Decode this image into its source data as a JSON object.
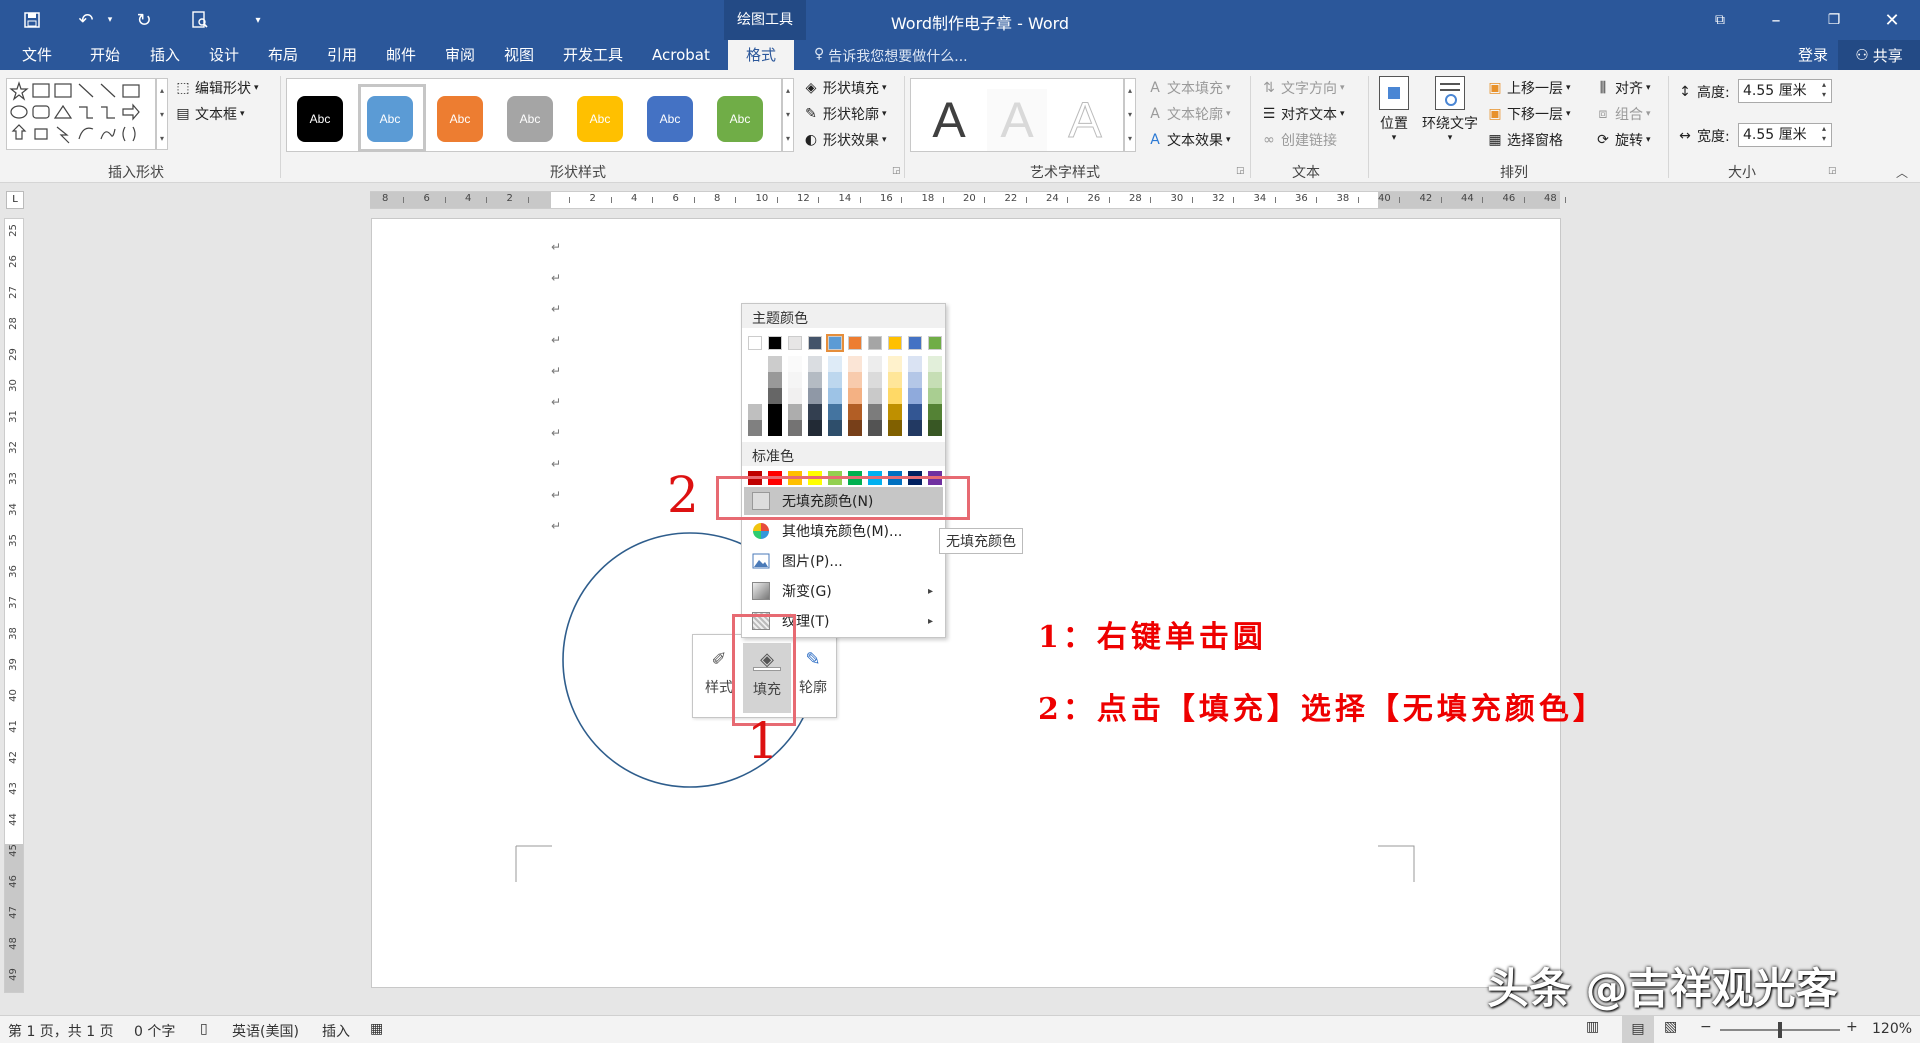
{
  "titlebar": {
    "context": "绘图工具",
    "title": "Word制作电子章 - Word"
  },
  "tabs": [
    "文件",
    "开始",
    "插入",
    "设计",
    "布局",
    "引用",
    "邮件",
    "审阅",
    "视图",
    "开发工具",
    "Acrobat",
    "格式"
  ],
  "active_tab": "格式",
  "tellme": "告诉我您想要做什么...",
  "account": {
    "login": "登录",
    "share": "共享"
  },
  "ribbon": {
    "insert_shapes": {
      "edit_shape": "编辑形状",
      "textbox": "文本框",
      "label": "插入形状"
    },
    "shape_styles": {
      "swatch_text": "Abc",
      "swatch_colors": [
        "#000000",
        "#5b9bd5",
        "#ed7d31",
        "#a5a5a5",
        "#ffc000",
        "#4472c4",
        "#70ad47"
      ],
      "fill": "形状填充",
      "outline": "形状轮廓",
      "effects": "形状效果",
      "label": "形状样式"
    },
    "wordart": {
      "letter": "A",
      "fill": "文本填充",
      "outline": "文本轮廓",
      "effects": "文本效果",
      "label": "艺术字样式"
    },
    "text": {
      "direction": "文字方向",
      "align": "对齐文本",
      "link": "创建链接",
      "label": "文本"
    },
    "arrange": {
      "position": "位置",
      "wrap": "环绕文字",
      "forward": "上移一层",
      "backward": "下移一层",
      "pane": "选择窗格",
      "align": "对齐",
      "group": "组合",
      "rotate": "旋转",
      "label": "排列"
    },
    "size": {
      "height_label": "高度:",
      "height": "4.55 厘米",
      "width_label": "宽度:",
      "width": "4.55 厘米",
      "label": "大小"
    }
  },
  "hruler_ticks": [
    "8",
    "6",
    "4",
    "2",
    "",
    "2",
    "4",
    "6",
    "8",
    "10",
    "12",
    "14",
    "16",
    "18",
    "20",
    "22",
    "24",
    "26",
    "28",
    "30",
    "32",
    "34",
    "36",
    "38",
    "40",
    "42",
    "44",
    "46",
    "48"
  ],
  "vruler_ticks": [
    "25",
    "26",
    "27",
    "28",
    "29",
    "30",
    "31",
    "32",
    "33",
    "34",
    "35",
    "36",
    "37",
    "38",
    "39",
    "40",
    "41",
    "42",
    "43",
    "44",
    "45",
    "46",
    "47",
    "48",
    "49"
  ],
  "para_mark": "↵",
  "menu": {
    "theme_title": "主题颜色",
    "theme_colors": [
      "#ffffff",
      "#000000",
      "#e7e6e6",
      "#44546a",
      "#5b9bd5",
      "#ed7d31",
      "#a5a5a5",
      "#ffc000",
      "#4472c4",
      "#70ad47"
    ],
    "standard_title": "标准色",
    "standard_colors": [
      "#c00000",
      "#ff0000",
      "#ffc000",
      "#ffff00",
      "#92d050",
      "#00b050",
      "#00b0f0",
      "#0070c0",
      "#002060",
      "#7030a0"
    ],
    "no_fill": "无填充颜色(N)",
    "more_colors": "其他填充颜色(M)...",
    "picture": "图片(P)...",
    "gradient": "渐变(G)",
    "texture": "纹理(T)"
  },
  "tooltip": "无填充颜色",
  "mini_toolbar": {
    "style": "样式",
    "fill": "填充",
    "outline": "轮廓"
  },
  "annotations": {
    "num1": "1",
    "num2": "2",
    "step1": "1：右键单击圆",
    "step2": "2：点击【填充】选择【无填充颜色】"
  },
  "statusbar": {
    "page": "第 1 页，共 1 页",
    "words": "0 个字",
    "lang": "英语(美国)",
    "mode": "插入",
    "zoom": "120%"
  },
  "watermark": "头条 @吉祥观光客"
}
